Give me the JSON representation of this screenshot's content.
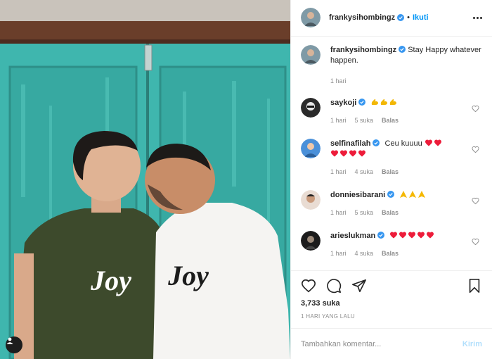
{
  "post": {
    "author": {
      "username": "frankysihombingz",
      "verified": true,
      "follow_label": "Ikuti",
      "separator": "•"
    },
    "caption": {
      "username": "frankysihombingz",
      "text": "Stay Happy whatever happen.",
      "time": "1 hari"
    },
    "photo": {
      "shirt_text_left": "Joy",
      "shirt_text_right": "Joy"
    }
  },
  "comments": [
    {
      "username": "saykoji",
      "text": "",
      "emojis": [
        "muscle",
        "muscle",
        "muscle"
      ],
      "time": "1 hari",
      "likes": "5 suka",
      "reply": "Balas"
    },
    {
      "username": "selfinafilah",
      "text": "Ceu kuuuu",
      "emojis": [
        "heart",
        "heart",
        "heart",
        "heart",
        "heart",
        "heart"
      ],
      "time": "1 hari",
      "likes": "4 suka",
      "reply": "Balas"
    },
    {
      "username": "donniesibarani",
      "text": "",
      "emojis": [
        "pray",
        "pray",
        "pray"
      ],
      "time": "1 hari",
      "likes": "5 suka",
      "reply": "Balas"
    },
    {
      "username": "arieslukman",
      "text": "",
      "emojis": [
        "heart",
        "heart",
        "heart",
        "heart"
      ],
      "time": "1 hari",
      "likes": "4 suka",
      "reply": "Balas"
    }
  ],
  "stats": {
    "likes": "3,733 suka",
    "posted": "1 HARI YANG LALU"
  },
  "composer": {
    "placeholder": "Tambahkan komentar...",
    "send_label": "Kirim"
  },
  "colors": {
    "accent": "#0095f6",
    "send_disabled": "#b2dffc",
    "heart": "#ed1c3a",
    "verified": "#3897f0",
    "door": "#3fb5ad"
  }
}
